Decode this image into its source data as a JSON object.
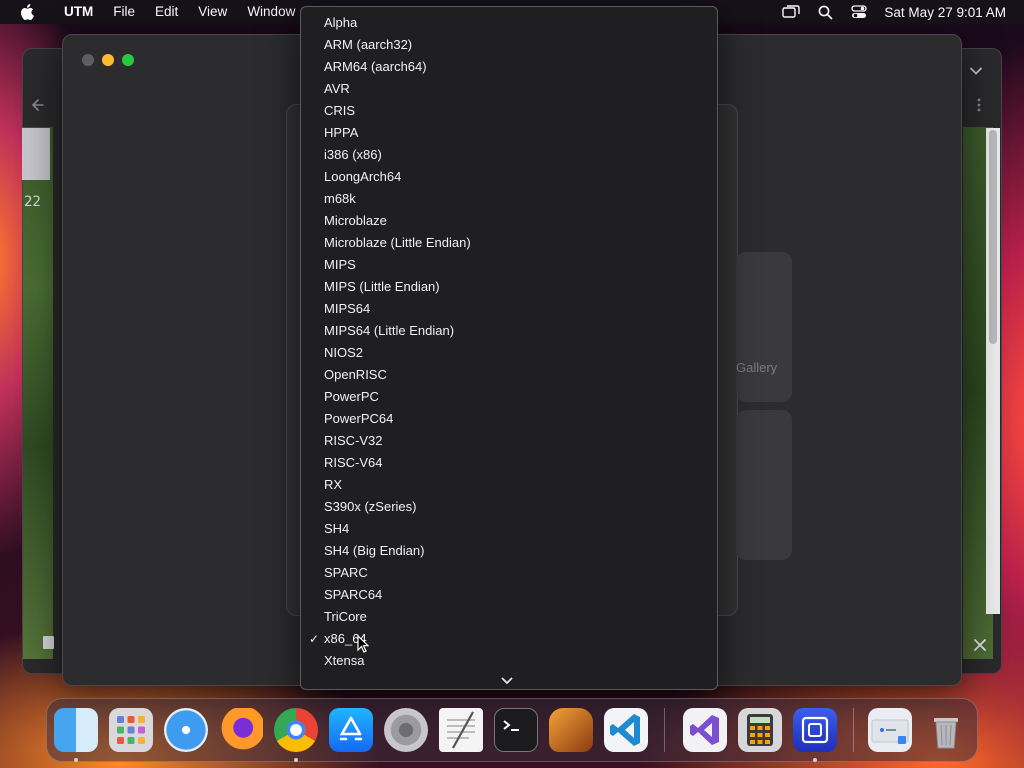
{
  "menubar": {
    "app_name": "UTM",
    "menus": [
      "File",
      "Edit",
      "View",
      "Window"
    ],
    "clock": "Sat May 27  9:01 AM"
  },
  "background": {
    "gallery_label": "Gallery",
    "number_label": "22"
  },
  "architecture_menu": {
    "items": [
      "Alpha",
      "ARM (aarch32)",
      "ARM64 (aarch64)",
      "AVR",
      "CRIS",
      "HPPA",
      "i386 (x86)",
      "LoongArch64",
      "m68k",
      "Microblaze",
      "Microblaze (Little Endian)",
      "MIPS",
      "MIPS (Little Endian)",
      "MIPS64",
      "MIPS64 (Little Endian)",
      "NIOS2",
      "OpenRISC",
      "PowerPC",
      "PowerPC64",
      "RISC-V32",
      "RISC-V64",
      "RX",
      "S390x (zSeries)",
      "SH4",
      "SH4 (Big Endian)",
      "SPARC",
      "SPARC64",
      "TriCore",
      "x86_64",
      "Xtensa"
    ],
    "selected": "x86_64",
    "check_mark": "✓"
  },
  "dock": {
    "apps": [
      "Finder",
      "Launchpad",
      "Safari",
      "Firefox",
      "Chrome",
      "App Store",
      "System Settings",
      "TextEdit",
      "Terminal",
      "GarageBand",
      "Visual Studio Code",
      "Visual Studio",
      "Calculator",
      "UTM",
      "Downloads",
      "Trash"
    ]
  },
  "colors": {
    "menu_bg": "#1f1f21",
    "traffic_close": "#5e5e60",
    "traffic_min": "#fdbc2f",
    "traffic_max": "#28c840"
  }
}
